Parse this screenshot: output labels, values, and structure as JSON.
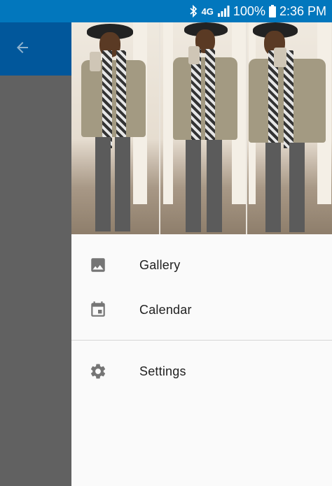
{
  "status_bar": {
    "network": "4G",
    "battery": "100%",
    "time": "2:36 PM",
    "icons": [
      "bluetooth-icon",
      "network-4g-icon",
      "signal-icon",
      "battery-icon"
    ]
  },
  "app_bar": {
    "back_icon": "arrow-back-icon"
  },
  "drawer": {
    "header_photos": [
      "photo-1",
      "photo-2",
      "photo-3"
    ],
    "items": [
      {
        "label": "Gallery",
        "icon": "image-icon"
      },
      {
        "label": "Calendar",
        "icon": "calendar-icon"
      }
    ],
    "settings": {
      "label": "Settings",
      "icon": "gear-icon"
    }
  },
  "colors": {
    "status_bar": "#0277bd",
    "app_bar": "#01579b",
    "scrim": "#616161",
    "drawer_bg": "#fafafa",
    "icon": "#757575",
    "text": "#212121"
  }
}
